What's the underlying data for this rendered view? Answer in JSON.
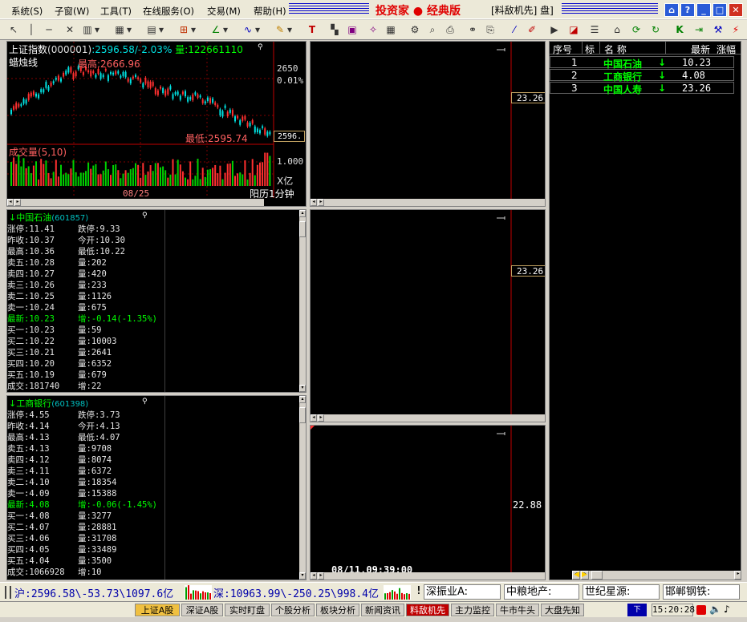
{
  "menu": {
    "items": [
      "系统(S)",
      "子窗(W)",
      "工具(T)",
      "在线服务(O)",
      "交易(M)",
      "帮助(H)"
    ]
  },
  "app": {
    "title": "投资家 ● 经典版",
    "subtitle": "[料敌机先] 盘]"
  },
  "chart": {
    "index_name": "上证指数",
    "index_code": "(000001)",
    "index_info": ":2596.58/-2.03%",
    "volume_label": "量:122661110",
    "style_label": "蜡烛线",
    "high_label": "最高:2666.96",
    "low_label": "最低:2595.74",
    "axis_top_value": "2650",
    "axis_pct": "0.01%",
    "current_tag": "2596.",
    "vol_title": "成交量(5,10)",
    "vol_axis": "1.000",
    "vol_unit": "X亿",
    "date_label": "08/25",
    "period_label": "阳历1分钟"
  },
  "quote1": {
    "name": "↓中国石油",
    "code": "(601857)",
    "rows_left": [
      "涨停:11.41",
      "昨收:10.37",
      "最高:10.36",
      "卖五:10.28",
      "卖四:10.27",
      "卖三:10.26",
      "卖二:10.25",
      "卖一:10.24",
      "最新:10.23",
      "买一:10.23",
      "买二:10.22",
      "买三:10.21",
      "买四:10.20",
      "买五:10.19",
      "成交:181740"
    ],
    "rows_right": [
      "跌停:9.33",
      "今开:10.30",
      "最低:10.22",
      "量:202",
      "量:420",
      "量:233",
      "量:1126",
      "量:675",
      "增:-0.14(-1.35%)",
      "量:59",
      "量:10003",
      "量:2641",
      "量:6352",
      "量:679",
      "增:22"
    ]
  },
  "quote2": {
    "name": "↓工商银行",
    "code": "(601398)",
    "rows_left": [
      "涨停:4.55",
      "昨收:4.14",
      "最高:4.13",
      "卖五:4.13",
      "卖四:4.12",
      "卖三:4.11",
      "卖二:4.10",
      "卖一:4.09",
      "最新:4.08",
      "买一:4.08",
      "买二:4.07",
      "买三:4.06",
      "买四:4.05",
      "买五:4.04",
      "成交:1066928"
    ],
    "rows_right": [
      "跌停:3.73",
      "今开:4.13",
      "最低:4.07",
      "量:9708",
      "量:8074",
      "量:6372",
      "量:18354",
      "量:15388",
      "增:-0.06(-1.45%)",
      "量:3277",
      "量:28881",
      "量:31708",
      "量:33489",
      "量:3500",
      "增:10"
    ]
  },
  "mini_charts": {
    "tag1": "23.26",
    "tag2": "23.26",
    "tag3": "22.88",
    "datetime": "08/11.09:39:00"
  },
  "list": {
    "headers": [
      "序号",
      "标",
      "名 称",
      "最新",
      "涨幅"
    ],
    "rows": [
      {
        "no": "1",
        "name": "中国石油",
        "arrow": "↓",
        "price": "10.23"
      },
      {
        "no": "2",
        "name": "工商银行",
        "arrow": "↓",
        "price": "4.08"
      },
      {
        "no": "3",
        "name": "中国人寿",
        "arrow": "↓",
        "price": "23.26"
      }
    ]
  },
  "status": {
    "sh": "沪:2596.58\\-53.73\\1097.6亿",
    "sz": "深:10963.99\\-250.25\\998.4亿",
    "exclaim": "!",
    "combos": [
      "深振业A:",
      "中粮地产:",
      "世纪星源:",
      "邯郸钢铁:"
    ]
  },
  "tabs": [
    "上证A股",
    "深证A股",
    "实时盯盘",
    "个股分析",
    "板块分析",
    "新闻资讯",
    "料敌机先",
    "主力监控",
    "牛市牛头",
    "大盘先知"
  ],
  "clock": "15:20:28",
  "colors": {
    "up": "#ff3030",
    "down": "#00ff00",
    "bg": "#000000",
    "active_tab": "#f0c040"
  }
}
